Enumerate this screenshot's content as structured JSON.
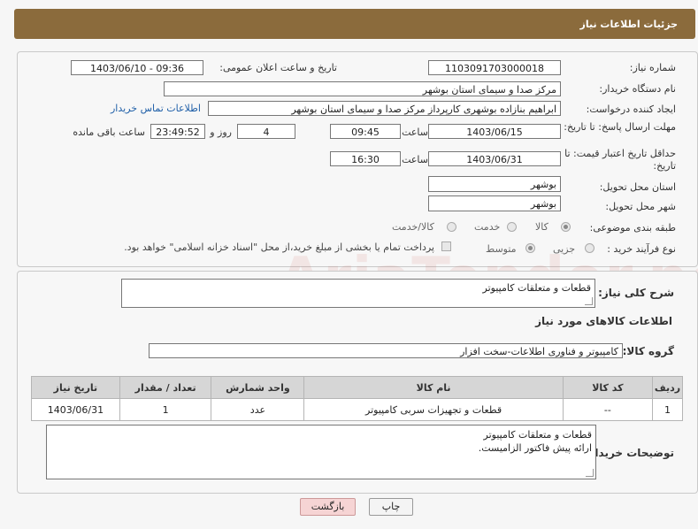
{
  "header": {
    "title": "جزئیات اطلاعات نیاز"
  },
  "fields": {
    "need_number_label": "شماره نیاز:",
    "need_number": "1103091703000018",
    "announce_label": "تاریخ و ساعت اعلان عمومی:",
    "announce_value": "1403/06/10 - 09:36",
    "buyer_org_label": "نام دستگاه خریدار:",
    "buyer_org": "مرکز صدا و سیمای استان بوشهر",
    "requester_label": "ایجاد کننده درخواست:",
    "requester": "ابراهیم بنازاده بوشهری کارپرداز مرکز صدا و سیمای استان بوشهر",
    "buyer_contact_link": "اطلاعات تماس خریدار",
    "deadline_label": "مهلت ارسال پاسخ: تا تاریخ:",
    "deadline_date": "1403/06/15",
    "time_label": "ساعت",
    "deadline_time": "09:45",
    "days_value": "4",
    "days_label": "روز و",
    "remaining_time": "23:49:52",
    "remaining_label": "ساعت باقی مانده",
    "price_validity_label": "حداقل تاریخ اعتبار قیمت: تا تاریخ:",
    "price_validity_date": "1403/06/31",
    "price_validity_time": "16:30",
    "province_label": "استان محل تحویل:",
    "province": "بوشهر",
    "city_label": "شهر محل تحویل:",
    "city": "بوشهر",
    "category_label": "طبقه بندی موضوعی:",
    "category_options": [
      "کالا",
      "خدمت",
      "کالا/خدمت"
    ],
    "process_label": "نوع فرآیند خرید :",
    "process_options": [
      "جزیی",
      "متوسط"
    ],
    "payment_note": "پرداخت تمام یا بخشی از مبلغ خرید،از محل \"اسناد خزانه اسلامی\" خواهد بود."
  },
  "details": {
    "summary_label": "شرح کلی نیاز:",
    "summary_value": "قطعات و متعلقات کامپیوتر",
    "goods_info_title": "اطلاعات کالاهای مورد نیاز",
    "goods_group_label": "گروه کالا:",
    "goods_group_value": "کامپیوتر و فناوری اطلاعات-سخت افزار",
    "table_headers": [
      "ردیف",
      "کد کالا",
      "نام کالا",
      "واحد شمارش",
      "تعداد / مقدار",
      "تاریخ نیاز"
    ],
    "rows": [
      {
        "index": "1",
        "code": "--",
        "name": "قطعات و تجهیزات سربی کامپیوتر",
        "unit": "عدد",
        "qty": "1",
        "date": "1403/06/31"
      }
    ],
    "buyer_notes_label": "توضیحات خریدار:",
    "buyer_notes_line1": "قطعات و متعلقات کامپیوتر",
    "buyer_notes_line2": "ارائه پیش فاکتور الزامیست."
  },
  "buttons": {
    "print": "چاپ",
    "back": "بازگشت"
  },
  "watermark": "AriaTender.neT",
  "colors": {
    "header": "#8b6b3c",
    "link": "#1f5fa8",
    "back_button": "#f6d4d4"
  }
}
